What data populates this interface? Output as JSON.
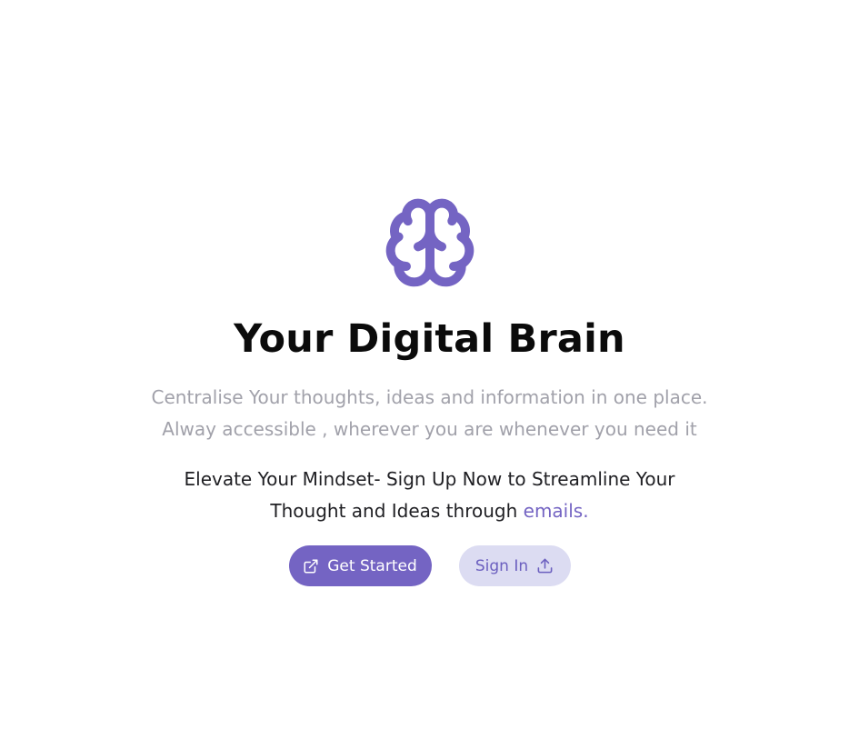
{
  "hero": {
    "title": "Your Digital Brain",
    "subtitle_line1": "Centralise Your thoughts, ideas and information in one place.",
    "subtitle_line2": "Alway accessible , wherever you are whenever you need it",
    "cta_text": "Elevate Your Mindset- Sign Up Now to Streamline Your Thought and Ideas through ",
    "cta_link": "emails."
  },
  "buttons": {
    "get_started": "Get Started",
    "sign_in": "Sign In"
  },
  "icons": {
    "logo": "brain-icon",
    "get_started": "external-link-icon",
    "sign_in": "upload-icon"
  },
  "colors": {
    "accent": "#7464c3",
    "secondary_bg": "#dcdcf2",
    "muted_text": "#a1a1aa"
  }
}
